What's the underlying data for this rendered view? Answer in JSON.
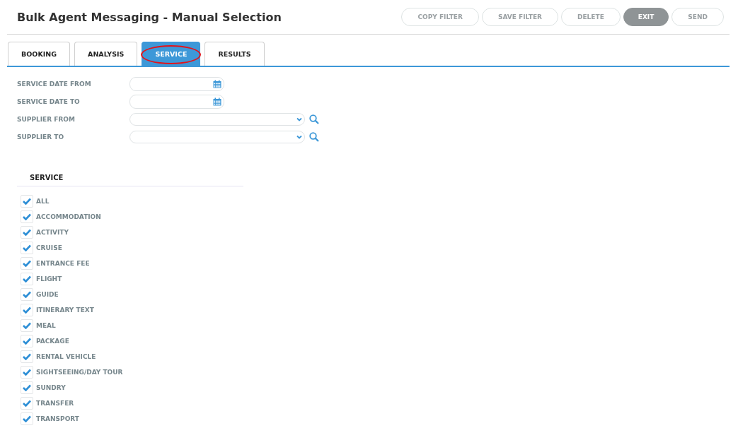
{
  "title": "Bulk Agent Messaging - Manual Selection",
  "buttons": [
    {
      "label": "COPY FILTER",
      "disabled": true
    },
    {
      "label": "SAVE FILTER",
      "disabled": true
    },
    {
      "label": "DELETE",
      "disabled": true
    },
    {
      "label": "EXIT",
      "disabled": false
    },
    {
      "label": "SEND",
      "disabled": true
    }
  ],
  "tabs": [
    {
      "label": "BOOKING",
      "selected": false,
      "highlighted": false
    },
    {
      "label": "ANALYSIS",
      "selected": false,
      "highlighted": false
    },
    {
      "label": "SERVICE",
      "selected": true,
      "highlighted": true
    },
    {
      "label": "RESULTS",
      "selected": false,
      "highlighted": false
    }
  ],
  "fields": [
    {
      "label": "SERVICE DATE FROM",
      "kind": "date"
    },
    {
      "label": "SERVICE DATE TO",
      "kind": "date"
    },
    {
      "label": "SUPPLIER FROM",
      "kind": "select"
    },
    {
      "label": "SUPPLIER TO",
      "kind": "select"
    }
  ],
  "service": {
    "heading": "SERVICE",
    "items": [
      {
        "label": "ALL",
        "checked": true
      },
      {
        "label": "ACCOMMODATION",
        "checked": true
      },
      {
        "label": "ACTIVITY",
        "checked": true
      },
      {
        "label": "CRUISE",
        "checked": true
      },
      {
        "label": "ENTRANCE FEE",
        "checked": true
      },
      {
        "label": "FLIGHT",
        "checked": true
      },
      {
        "label": "GUIDE",
        "checked": true
      },
      {
        "label": "ITINERARY TEXT",
        "checked": true
      },
      {
        "label": "MEAL",
        "checked": true
      },
      {
        "label": "PACKAGE",
        "checked": true
      },
      {
        "label": "RENTAL VEHICLE",
        "checked": true
      },
      {
        "label": "SIGHTSEEING/DAY TOUR",
        "checked": true
      },
      {
        "label": "SUNDRY",
        "checked": true
      },
      {
        "label": "TRANSFER",
        "checked": true
      },
      {
        "label": "TRANSPORT",
        "checked": true
      }
    ]
  }
}
